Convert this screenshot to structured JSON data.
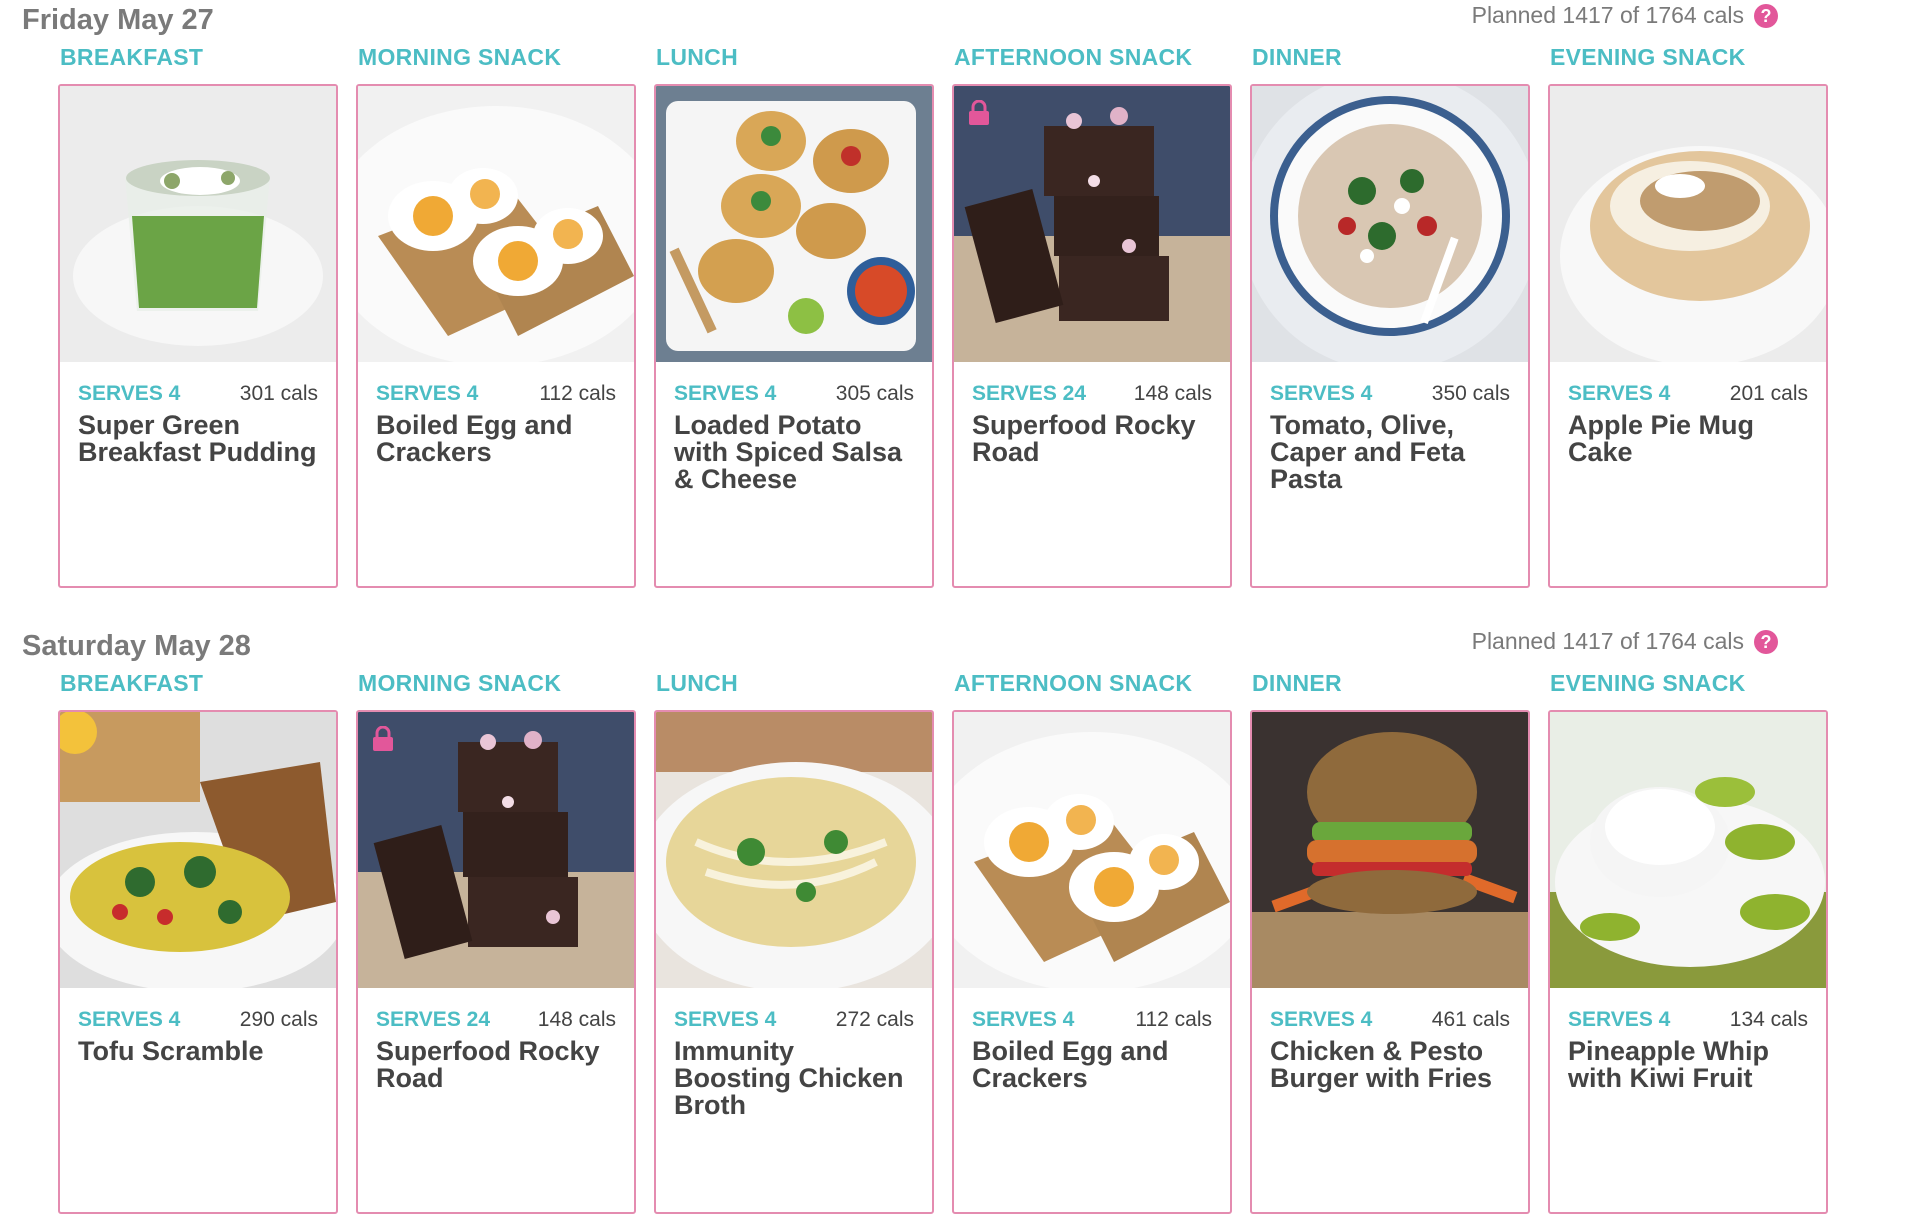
{
  "days": [
    {
      "title": "Friday May 27",
      "planned": "Planned 1417 of 1764 cals",
      "meals": [
        {
          "label": "BREAKFAST",
          "serves": "SERVES 4",
          "cals": "301 cals",
          "title": "Super Green Breakfast Pudding",
          "locked": false
        },
        {
          "label": "MORNING SNACK",
          "serves": "SERVES 4",
          "cals": "112 cals",
          "title": "Boiled Egg and Crackers",
          "locked": false
        },
        {
          "label": "LUNCH",
          "serves": "SERVES 4",
          "cals": "305 cals",
          "title": "Loaded Potato with Spiced Salsa & Cheese",
          "locked": false
        },
        {
          "label": "AFTERNOON SNACK",
          "serves": "SERVES 24",
          "cals": "148 cals",
          "title": "Superfood Rocky Road",
          "locked": true
        },
        {
          "label": "DINNER",
          "serves": "SERVES 4",
          "cals": "350 cals",
          "title": "Tomato, Olive, Caper and Feta Pasta",
          "locked": false
        },
        {
          "label": "EVENING SNACK",
          "serves": "SERVES 4",
          "cals": "201 cals",
          "title": "Apple Pie Mug Cake",
          "locked": false
        }
      ]
    },
    {
      "title": "Saturday May 28",
      "planned": "Planned 1417 of 1764 cals",
      "meals": [
        {
          "label": "BREAKFAST",
          "serves": "SERVES 4",
          "cals": "290 cals",
          "title": "Tofu Scramble",
          "locked": false
        },
        {
          "label": "MORNING SNACK",
          "serves": "SERVES 24",
          "cals": "148 cals",
          "title": "Superfood Rocky Road",
          "locked": true
        },
        {
          "label": "LUNCH",
          "serves": "SERVES 4",
          "cals": "272 cals",
          "title": "Immunity Boosting Chicken Broth",
          "locked": false
        },
        {
          "label": "AFTERNOON SNACK",
          "serves": "SERVES 4",
          "cals": "112 cals",
          "title": "Boiled Egg and Crackers",
          "locked": false
        },
        {
          "label": "DINNER",
          "serves": "SERVES 4",
          "cals": "461 cals",
          "title": "Chicken & Pesto Burger with Fries",
          "locked": false
        },
        {
          "label": "EVENING SNACK",
          "serves": "SERVES 4",
          "cals": "134 cals",
          "title": "Pineapple Whip with Kiwi Fruit",
          "locked": false
        }
      ]
    }
  ],
  "icons": {
    "help": "question-circle-icon",
    "lock": "lock-icon"
  },
  "colors": {
    "accent": "#4cbdc4",
    "card_border": "#e48cb0",
    "lock": "#e2579a"
  }
}
